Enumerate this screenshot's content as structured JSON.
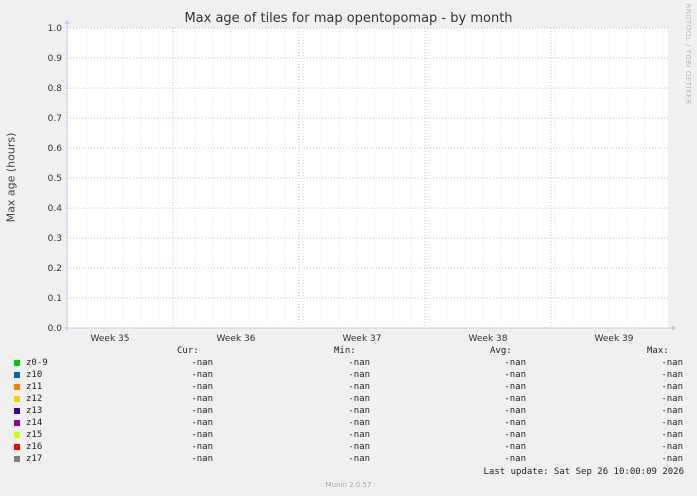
{
  "chart_data": {
    "type": "line",
    "title": "Max age of tiles for map opentopomap - by month",
    "ylabel": "Max age (hours)",
    "xlabel": "",
    "ylim": [
      0.0,
      1.0
    ],
    "yticks": [
      "0.0",
      "0.1",
      "0.2",
      "0.3",
      "0.4",
      "0.5",
      "0.6",
      "0.7",
      "0.8",
      "0.9",
      "1.0"
    ],
    "xticks": [
      "Week 35",
      "Week 36",
      "Week 37",
      "Week 38",
      "Week 39"
    ],
    "grid": true,
    "series": [
      {
        "name": "z0-9",
        "color": "#00cc00",
        "cur": "-nan",
        "min": "-nan",
        "avg": "-nan",
        "max": "-nan"
      },
      {
        "name": "z10",
        "color": "#0066b3",
        "cur": "-nan",
        "min": "-nan",
        "avg": "-nan",
        "max": "-nan"
      },
      {
        "name": "z11",
        "color": "#ff8000",
        "cur": "-nan",
        "min": "-nan",
        "avg": "-nan",
        "max": "-nan"
      },
      {
        "name": "z12",
        "color": "#ffcc00",
        "cur": "-nan",
        "min": "-nan",
        "avg": "-nan",
        "max": "-nan"
      },
      {
        "name": "z13",
        "color": "#330099",
        "cur": "-nan",
        "min": "-nan",
        "avg": "-nan",
        "max": "-nan"
      },
      {
        "name": "z14",
        "color": "#990099",
        "cur": "-nan",
        "min": "-nan",
        "avg": "-nan",
        "max": "-nan"
      },
      {
        "name": "z15",
        "color": "#ccff00",
        "cur": "-nan",
        "min": "-nan",
        "avg": "-nan",
        "max": "-nan"
      },
      {
        "name": "z16",
        "color": "#ff0000",
        "cur": "-nan",
        "min": "-nan",
        "avg": "-nan",
        "max": "-nan"
      },
      {
        "name": "z17",
        "color": "#808080",
        "cur": "-nan",
        "min": "-nan",
        "avg": "-nan",
        "max": "-nan"
      }
    ]
  },
  "legend_headers": {
    "cur": "Cur:",
    "min": "Min:",
    "avg": "Avg:",
    "max": "Max:"
  },
  "last_update": "Last update: Sat Sep 26 10:00:09 2026",
  "watermark": "RRDTOOL / TOBI OETIKER",
  "version": "Munin 2.0.57"
}
